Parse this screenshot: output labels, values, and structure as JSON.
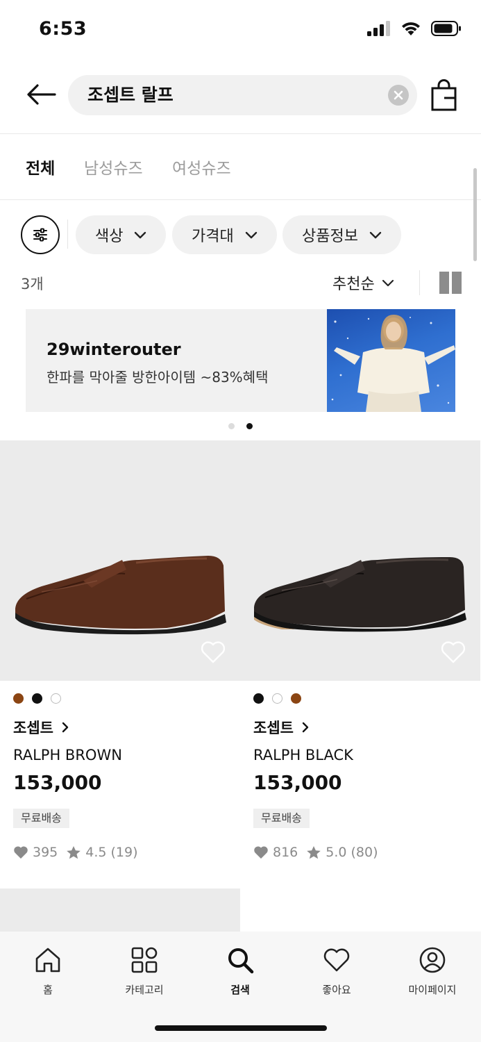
{
  "status_bar": {
    "time": "6:53"
  },
  "search": {
    "query": "조셉트 랄프"
  },
  "tabs": [
    {
      "label": "전체",
      "active": true
    },
    {
      "label": "남성슈즈",
      "active": false
    },
    {
      "label": "여성슈즈",
      "active": false
    }
  ],
  "filters": {
    "chips": [
      {
        "label": "색상"
      },
      {
        "label": "가격대"
      },
      {
        "label": "상품정보"
      }
    ]
  },
  "results": {
    "count": "3개",
    "sort_label": "추천순"
  },
  "banner": {
    "title": "29winterouter",
    "subtitle": "한파를 막아줄 방한아이템 ~83%혜택",
    "active_index": 1,
    "total": 2
  },
  "products": [
    {
      "brand": "조셉트",
      "name": "RALPH BROWN",
      "price": "153,000",
      "badge": "무료배송",
      "likes": "395",
      "rating": "4.5 (19)",
      "swatches": [
        "#8b4513",
        "#111111",
        "#ffffff"
      ],
      "shoe_color": "#5a2e1c"
    },
    {
      "brand": "조셉트",
      "name": "RALPH BLACK",
      "price": "153,000",
      "badge": "무료배송",
      "likes": "816",
      "rating": "5.0 (80)",
      "swatches": [
        "#111111",
        "#ffffff",
        "#8b4513"
      ],
      "shoe_color": "#2a2422"
    }
  ],
  "bottom_nav": [
    {
      "label": "홈",
      "icon": "home-icon",
      "active": false
    },
    {
      "label": "카테고리",
      "icon": "category-grid-icon",
      "active": false
    },
    {
      "label": "검색",
      "icon": "search-icon",
      "active": true
    },
    {
      "label": "좋아요",
      "icon": "heart-icon",
      "active": false
    },
    {
      "label": "마이페이지",
      "icon": "profile-icon",
      "active": false
    }
  ]
}
